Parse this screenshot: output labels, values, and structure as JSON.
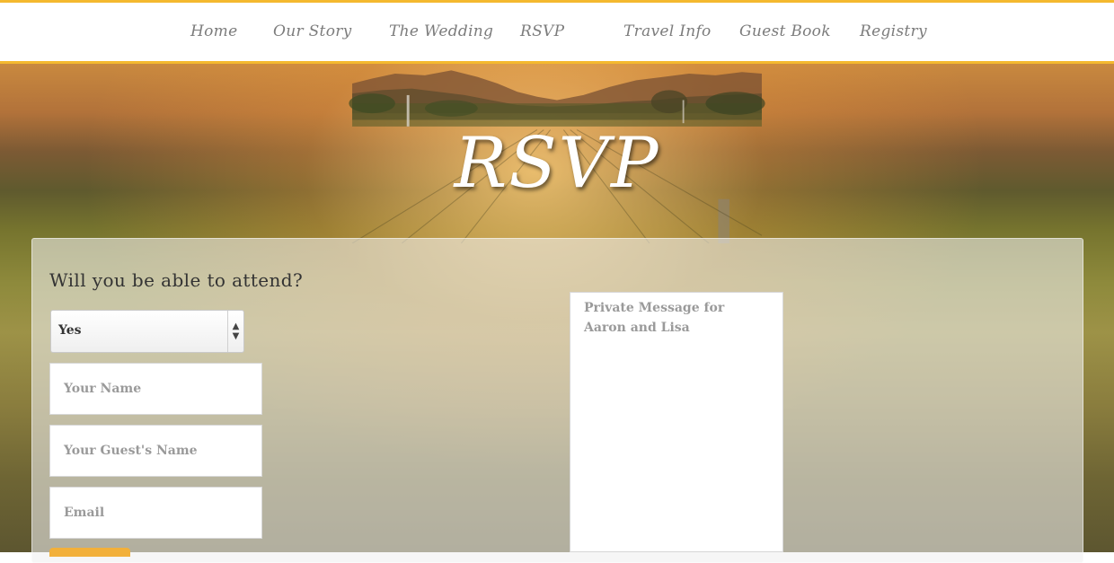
{
  "nav": {
    "items": [
      {
        "label": "Home"
      },
      {
        "label": "Our Story"
      },
      {
        "label": "The Wedding"
      },
      {
        "label": "RSVP"
      },
      {
        "label": "Travel Info"
      },
      {
        "label": "Guest Book"
      },
      {
        "label": "Registry"
      }
    ]
  },
  "hero": {
    "title": "RSVP"
  },
  "form": {
    "question": "Will you be able to attend?",
    "attend_select": {
      "selected": "Yes"
    },
    "name_placeholder": "Your Name",
    "guest_placeholder": "Your Guest's Name",
    "email_placeholder": "Email",
    "message_placeholder": "Private Message for Aaron and Lisa"
  },
  "colors": {
    "accent": "#f4b92f",
    "nav_text": "#7c7c7c"
  }
}
